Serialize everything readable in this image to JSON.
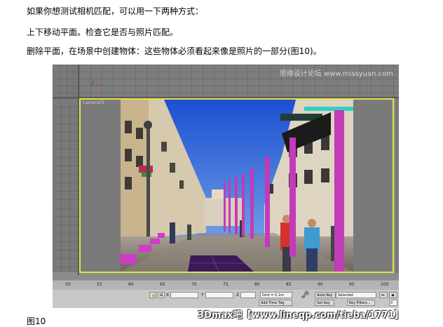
{
  "paragraphs": {
    "line1": "如果你想测试相机匹配，可以用一下两种方式：",
    "line2": "上下移动平面。检查它是否与照片匹配。",
    "line3": "删除平面，在场景中创建物体：这些物体必须看起来像是照片的一部分(图10)。"
  },
  "viewport": {
    "camera_label": "Camera01",
    "top_watermark": "思缘设计论坛 www.missyuan.com"
  },
  "timeline": {
    "ticks": [
      "50",
      "55",
      "60",
      "65",
      "70",
      "75",
      "80",
      "85",
      "90",
      "95",
      "100"
    ]
  },
  "status": {
    "x_label": "X",
    "y_label": "Y",
    "z_label": "Z",
    "grid": "Grid = 0.1m",
    "auto_key": "Auto Key",
    "selected": "Selected",
    "set_key": "Set Key",
    "key_filters": "Key Filters...",
    "add_time_tag": "Add Time Tag",
    "frame_value": "0"
  },
  "caption": "图10",
  "watermark": "3Dmax吧【www.lineqp.com/tieba/1771】",
  "colors": {
    "viewport_border": "#e3e34b",
    "pillar": "#c23bb8",
    "plane": "#3a1a5a"
  }
}
